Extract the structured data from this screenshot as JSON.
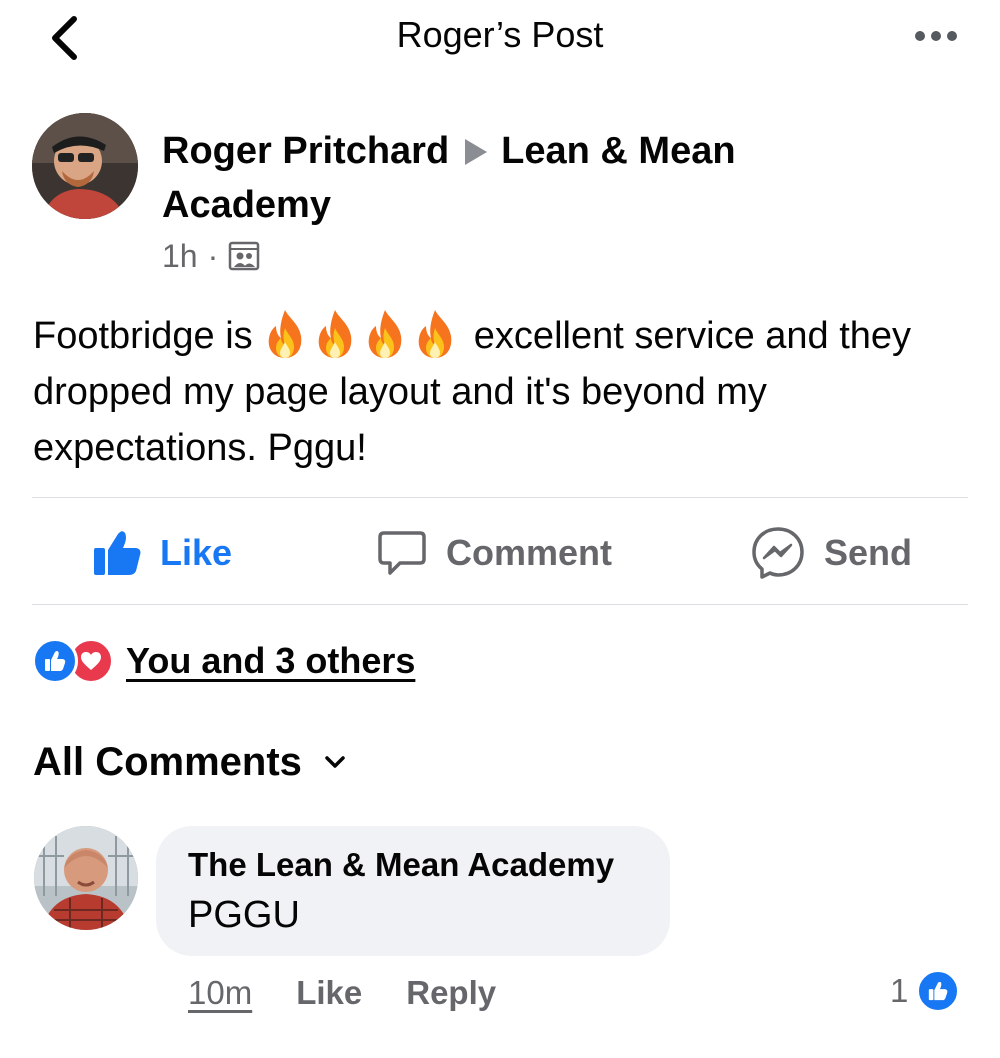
{
  "header": {
    "title": "Roger’s Post"
  },
  "post": {
    "author": "Roger Pritchard",
    "group": "Lean & Mean Academy",
    "time": "1h",
    "text_before": "Footbridge is",
    "emoji": [
      "fire",
      "fire",
      "fire",
      "fire"
    ],
    "text_after": "excellent service and they dropped my page layout and it's beyond my expectations. Pggu!"
  },
  "actions": {
    "like": "Like",
    "comment": "Comment",
    "send": "Send"
  },
  "reactions": {
    "text": "You and 3 others",
    "types": [
      "like",
      "love"
    ]
  },
  "comments_header": {
    "label": "All Comments"
  },
  "comment": {
    "author": "The Lean & Mean Academy",
    "text": "PGGU",
    "time": "10m",
    "like": "Like",
    "reply": "Reply",
    "like_count": "1"
  },
  "colors": {
    "accent": "#1877f2",
    "love": "#e8394d",
    "muted": "#65676b"
  }
}
